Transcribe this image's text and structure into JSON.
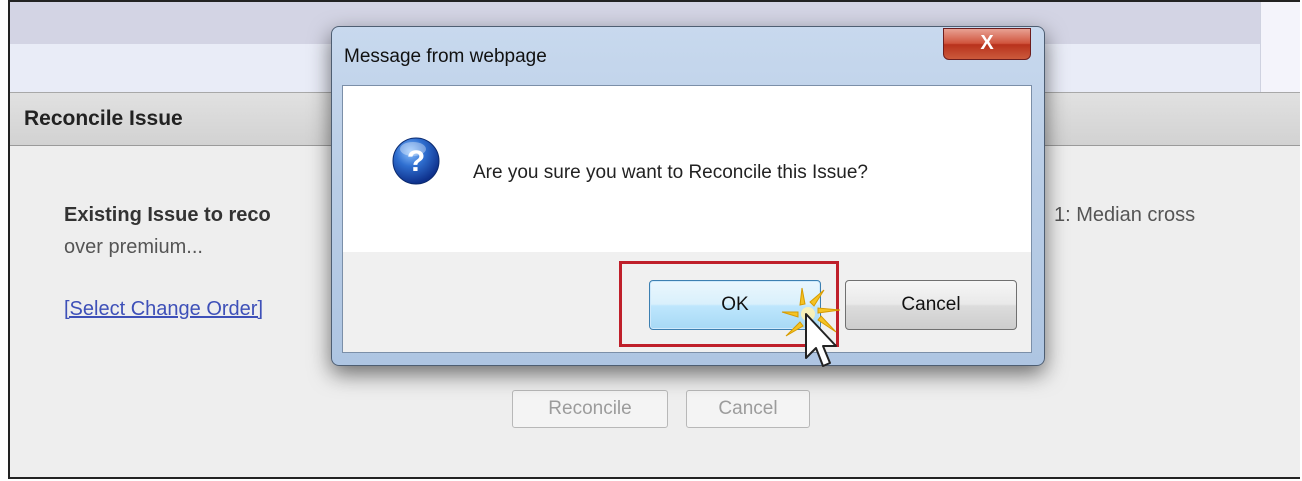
{
  "page": {
    "panel_title": "Reconcile Issue",
    "existing_label": "Existing Issue to reco",
    "existing_right": "1: Median cross",
    "existing_desc": "over premium...",
    "select_link": "[Select Change Order]",
    "reconcile_button": "Reconcile",
    "cancel_button": "Cancel"
  },
  "dialog": {
    "title": "Message from webpage",
    "close_label": "X",
    "icon": "question-icon",
    "message": "Are you sure you want to Reconcile this Issue?",
    "ok_label": "OK",
    "cancel_label": "Cancel"
  },
  "annotation": {
    "highlight_color": "#bf1f2a",
    "pointer": "mouse-pointer-click-icon"
  }
}
